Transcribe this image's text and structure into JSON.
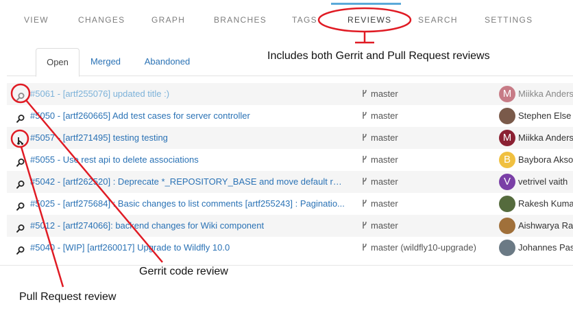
{
  "topnav": {
    "items": [
      {
        "label": "VIEW"
      },
      {
        "label": "CHANGES"
      },
      {
        "label": "GRAPH"
      },
      {
        "label": "BRANCHES"
      },
      {
        "label": "TAGS"
      },
      {
        "label": "REVIEWS"
      },
      {
        "label": "SEARCH"
      },
      {
        "label": "SETTINGS"
      }
    ],
    "active": "REVIEWS"
  },
  "tabs": [
    {
      "label": "Open"
    },
    {
      "label": "Merged"
    },
    {
      "label": "Abandoned"
    }
  ],
  "reviews": [
    {
      "title": "#5061 - [artf255076] updated title :)",
      "branch": "master",
      "author": "Miikka Anders",
      "avatar_letter": "M",
      "avatar_color": "#c77b86",
      "icon": "magnifier-icon"
    },
    {
      "title": "#5050 - [artf260665] Add test cases for server controller",
      "branch": "master",
      "author": "Stephen Else",
      "avatar_letter": "",
      "avatar_color": "#7a5a4a",
      "icon": "magnifier-icon"
    },
    {
      "title": "#5057 - [artf271495] testing testing",
      "branch": "master",
      "author": "Miikka Anders",
      "avatar_letter": "M",
      "avatar_color": "#8b2133",
      "icon": "branch-icon"
    },
    {
      "title": "#5055 - Use rest api to delete associations",
      "branch": "master",
      "author": "Baybora Akso",
      "avatar_letter": "B",
      "avatar_color": "#f0c040",
      "icon": "magnifier-icon"
    },
    {
      "title": "#5042 - [artf262520] : Deprecate *_REPOSITORY_BASE and move default rep...",
      "branch": "master",
      "author": "vetrivel vaith",
      "avatar_letter": "V",
      "avatar_color": "#7a3fa6",
      "icon": "magnifier-icon"
    },
    {
      "title": "#5025 - [artf275684] : Basic changes to list comments [artf255243] : Paginatio...",
      "branch": "master",
      "author": "Rakesh Kuma",
      "avatar_letter": "",
      "avatar_color": "#556b3d",
      "icon": "magnifier-icon"
    },
    {
      "title": "#5012 - [artf274066]: backend changes for Wiki component",
      "branch": "master",
      "author": "Aishwarya Ra",
      "avatar_letter": "",
      "avatar_color": "#a0703a",
      "icon": "magnifier-icon"
    },
    {
      "title": "#5040 - [WIP] [artf260017] Upgrade to Wildfly 10.0",
      "branch": "master (wildfly10-upgrade)",
      "author": "Johannes Pas",
      "avatar_letter": "",
      "avatar_color": "#6b7a85",
      "icon": "magnifier-icon"
    }
  ],
  "annotations": {
    "reviews_note": "Includes both Gerrit and Pull Request reviews",
    "gerrit_note": "Gerrit code review",
    "pr_note": "Pull Request review"
  },
  "colors": {
    "link": "#2a72b5",
    "accent": "#5aa9d9",
    "annotation": "#e01b24"
  }
}
